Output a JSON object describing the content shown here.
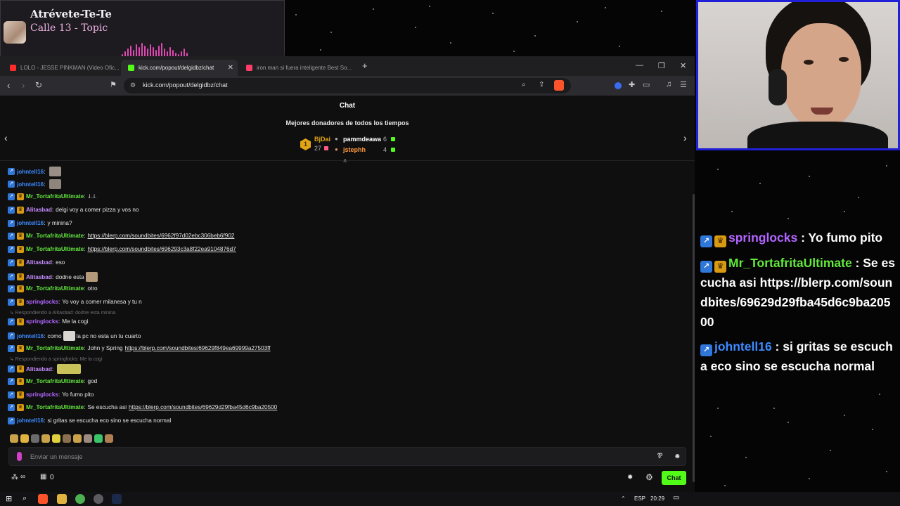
{
  "music": {
    "song": "Atrévete-Te-Te",
    "artist": "Calle 13 - Topic",
    "icon": "album-art"
  },
  "browser": {
    "tabs": [
      {
        "label": "LOLO - JESSE PINKMAN (Video Ofic...",
        "favicon_color": "#ff2b2b"
      },
      {
        "label": "kick.com/popout/delgidbz/chat",
        "favicon_color": "#53fc18"
      },
      {
        "label": "iron man si fuera inteligente Best So...",
        "favicon_color": "#ff3b6a"
      }
    ],
    "url": "kick.com/popout/delgidbz/chat"
  },
  "chat": {
    "title": "Chat",
    "donors_title": "Mejores donadores de todos los tiempos",
    "donors": {
      "first": {
        "rank": "1",
        "name": "BjDai",
        "amount": "27"
      },
      "second": {
        "name": "pammdeawa",
        "amount": "6"
      },
      "third": {
        "name": "jstephh",
        "amount": "4"
      }
    },
    "messages": [
      {
        "user": "johntell16",
        "text": "",
        "badges": [
          "blue"
        ],
        "color": "#3d8bff"
      },
      {
        "user": "johntell16",
        "text": "",
        "badges": [
          "blue"
        ],
        "color": "#3d8bff"
      },
      {
        "user": "Mr_TortafritaUltimate",
        "text": ".i..i.",
        "badges": [
          "blue",
          "gold"
        ],
        "color": "#63e83c"
      },
      {
        "user": "Alitasbad",
        "text": "delgi voy a comer pizza y vos no",
        "badges": [
          "blue",
          "gold"
        ],
        "color": "#c78cff"
      },
      {
        "user": "johntell16",
        "text": "y minina?",
        "badges": [
          "blue"
        ],
        "color": "#3d8bff"
      },
      {
        "user": "Mr_TortafritaUltimate",
        "text": "https://blerp.com/soundbites/6962f97d02ebc306beb6f902",
        "badges": [
          "blue",
          "gold"
        ],
        "color": "#63e83c",
        "link": true
      },
      {
        "user": "Mr_TortafritaUltimate",
        "text": "https://blerp.com/soundbites/696293c3a8f22ea9104876d7",
        "badges": [
          "blue",
          "gold"
        ],
        "color": "#63e83c",
        "link": true
      },
      {
        "user": "Alitasbad",
        "text": "eso",
        "badges": [
          "blue",
          "gold"
        ],
        "color": "#c78cff"
      },
      {
        "user": "Alitasbad",
        "text": "dodne esta",
        "badges": [
          "blue",
          "gold"
        ],
        "color": "#c78cff"
      },
      {
        "user": "Mr_TortafritaUltimate",
        "text": "otro",
        "badges": [
          "blue",
          "gold"
        ],
        "color": "#63e83c"
      },
      {
        "user": "springlocks",
        "text": "Yo voy a comer milanesa y tu n",
        "badges": [
          "blue",
          "gold"
        ],
        "color": "#b366ff"
      },
      {
        "user": "springlocks",
        "text": "Me la cogi",
        "badges": [
          "blue",
          "gold"
        ],
        "color": "#b366ff"
      },
      {
        "user": "johntell16",
        "text": "como",
        "text2": "la pc no esta un tu cuarto",
        "badges": [
          "blue"
        ],
        "color": "#3d8bff"
      },
      {
        "user": "Mr_TortafritaUltimate",
        "text": "John y Spring",
        "link_text": "https://blerp.com/soundbites/69629f849ea69999a27503ff",
        "badges": [
          "blue",
          "gold"
        ],
        "color": "#63e83c"
      },
      {
        "user": "Alitasbad",
        "text": "",
        "badges": [
          "blue",
          "gold"
        ],
        "color": "#c78cff"
      },
      {
        "user": "Mr_TortafritaUltimate",
        "text": "god",
        "badges": [
          "blue",
          "gold"
        ],
        "color": "#63e83c"
      },
      {
        "user": "springlocks",
        "text": "Yo fumo pito",
        "badges": [
          "blue",
          "gold"
        ],
        "color": "#b366ff"
      },
      {
        "user": "Mr_TortafritaUltimate",
        "text": "Se escucha asi",
        "link_text": "https://blerp.com/soundbites/69629d29fba45d6c9ba20500",
        "badges": [
          "blue",
          "gold"
        ],
        "color": "#63e83c"
      },
      {
        "user": "johntell16",
        "text": "si gritas se escucha eco sino se escucha normal",
        "badges": [
          "blue"
        ],
        "color": "#3d8bff"
      }
    ],
    "replies": [
      "Respondiendo a Alitasbad: dodne esta minina",
      "Respondiendo a springlocks: Me la cogi"
    ],
    "input_placeholder": "Enviar un mensaje",
    "infinity": "∞",
    "gift_count": "0",
    "chat_button": "Chat"
  },
  "overlay": [
    {
      "user": "springlocks",
      "text": " : Yo fumo pito",
      "color": "#b366ff"
    },
    {
      "user": "Mr_TortafritaUltimate",
      "text": " : Se escucha asi https://blerp.com/soundbites/69629d29fba45d6c9ba20500",
      "color": "#63e83c"
    },
    {
      "user": "johntell16",
      "text": " : si gritas se escucha eco sino se escucha normal",
      "color": "#3d8bff"
    }
  ],
  "taskbar": {
    "lang": "ESP",
    "time": "20:29"
  }
}
